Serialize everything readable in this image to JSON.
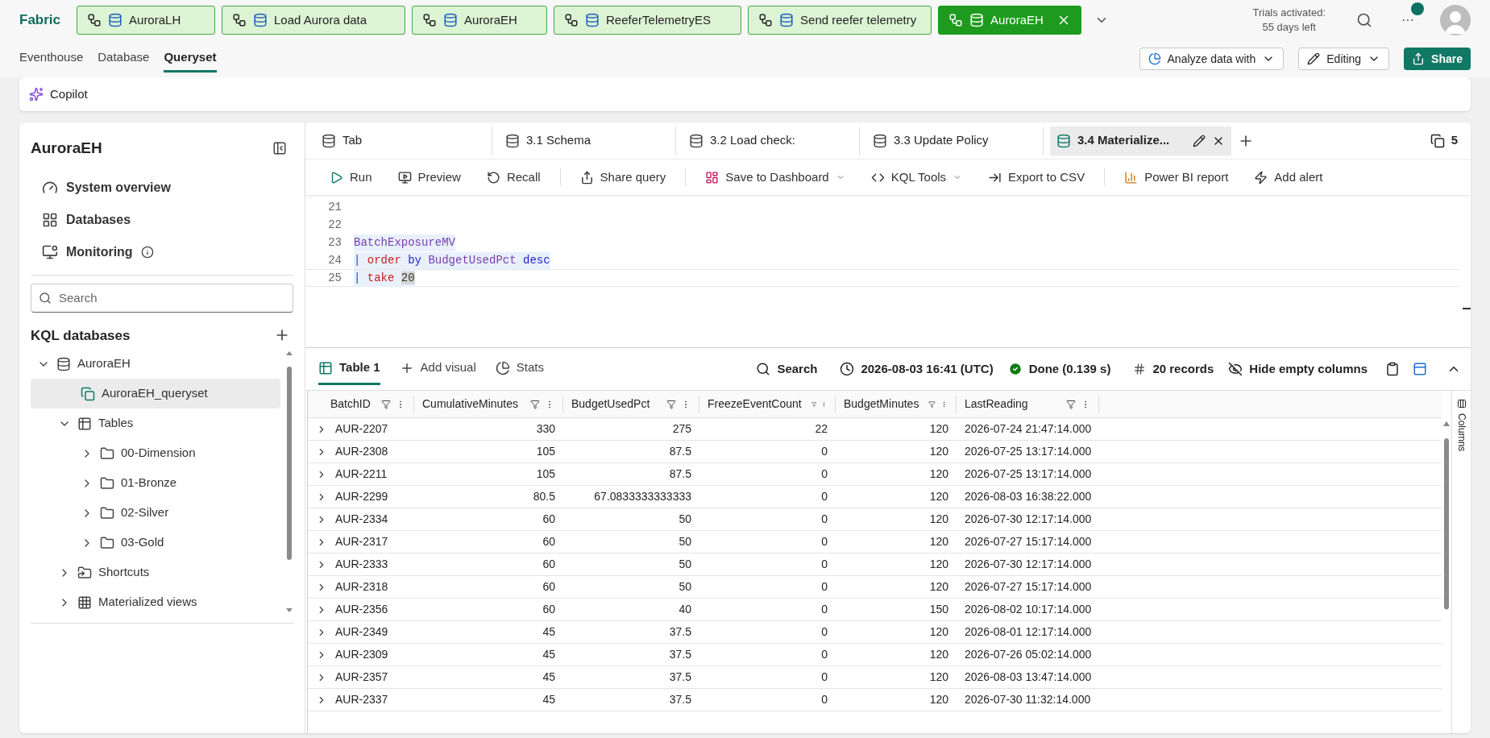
{
  "app_bar": {
    "brand": "Fabric",
    "tabs": [
      {
        "label": "AuroraLH",
        "selected": false
      },
      {
        "label": "Load Aurora data",
        "selected": false
      },
      {
        "label": "AuroraEH",
        "selected": false
      },
      {
        "label": "ReeferTelemetryES",
        "selected": false
      },
      {
        "label": "Send reefer telemetry",
        "selected": false
      },
      {
        "label": "AuroraEH",
        "selected": true
      }
    ],
    "trial": [
      "Trials activated:",
      "55 days left"
    ],
    "more": "···"
  },
  "nav_tabs": [
    {
      "label": "Eventhouse",
      "selected": false
    },
    {
      "label": "Database",
      "selected": false
    },
    {
      "label": "Queryset",
      "selected": true
    }
  ],
  "actions": [
    {
      "label": "Analyze data with",
      "kind": "menu"
    },
    {
      "label": "Editing",
      "kind": "menu"
    },
    {
      "label": "Share",
      "kind": "primary"
    }
  ],
  "copilot": {
    "label": "Copilot"
  },
  "sidebar": {
    "title": "AuroraEH",
    "nav": [
      {
        "label": "System overview",
        "info": false
      },
      {
        "label": "Databases",
        "info": false
      },
      {
        "label": "Monitoring",
        "info": true
      }
    ],
    "search": {
      "placeholder": "Search"
    },
    "section": "KQL databases",
    "tree": [
      {
        "label": "AuroraEH",
        "kind": "database",
        "expanded": true,
        "selected": false,
        "children": [
          {
            "label": "AuroraEH_queryset",
            "kind": "queryset",
            "selected": true
          },
          {
            "label": "Tables",
            "kind": "tables",
            "expanded": true,
            "selected": false,
            "children": [
              {
                "label": "00-Dimension",
                "kind": "folder",
                "expanded": false,
                "selected": false
              },
              {
                "label": "01-Bronze",
                "kind": "folder",
                "expanded": false,
                "selected": false
              },
              {
                "label": "02-Silver",
                "kind": "folder",
                "expanded": false,
                "selected": false
              },
              {
                "label": "03-Gold",
                "kind": "folder",
                "expanded": false,
                "selected": false
              }
            ]
          },
          {
            "label": "Shortcuts",
            "kind": "shortcuts",
            "expanded": false,
            "selected": false
          },
          {
            "label": "Materialized views",
            "kind": "views",
            "expanded": false,
            "selected": false
          }
        ]
      }
    ]
  },
  "query_tabs": [
    {
      "label": "Tab",
      "selected": false
    },
    {
      "label": "3.1 Schema",
      "selected": false
    },
    {
      "label": "3.2 Load check:",
      "selected": false
    },
    {
      "label": "3.3 Update Policy",
      "selected": false
    },
    {
      "label": "3.4 Materialize...",
      "selected": true
    }
  ],
  "tab_count": "5",
  "toolbar": [
    {
      "items": [
        {
          "label": "Run",
          "caret": false
        },
        {
          "label": "Preview",
          "caret": false
        },
        {
          "label": "Recall",
          "caret": false
        }
      ]
    },
    {
      "items": [
        {
          "label": "Share query",
          "caret": false
        }
      ]
    },
    {
      "items": [
        {
          "label": "Save to Dashboard",
          "caret": true
        },
        {
          "label": "KQL Tools",
          "caret": true
        },
        {
          "label": "Export to CSV",
          "caret": false
        }
      ]
    },
    {
      "items": [
        {
          "label": "Power BI report",
          "caret": false
        },
        {
          "label": "Add alert",
          "caret": false
        }
      ]
    }
  ],
  "editor": {
    "lines": [
      {
        "number": "21"
      },
      {
        "number": "22"
      },
      {
        "number": "23",
        "tokens": [
          {
            "text": "BatchExposureMV",
            "kind": "table"
          }
        ]
      },
      {
        "number": "24",
        "tokens": [
          {
            "text": "|",
            "kind": "pipe"
          },
          {
            "text": "order",
            "kind": "operator"
          },
          {
            "text": "by",
            "kind": "keyword"
          },
          {
            "text": "BudgetUsedPct",
            "kind": "column"
          },
          {
            "text": "desc",
            "kind": "keyword"
          }
        ]
      },
      {
        "number": "25",
        "tokens": [
          {
            "text": "|",
            "kind": "pipe"
          },
          {
            "text": "take",
            "kind": "operator"
          },
          {
            "text": "20",
            "kind": "number"
          }
        ]
      }
    ]
  },
  "results": {
    "tabs": [
      {
        "label": "Table 1",
        "selected": true
      },
      {
        "label": "Add visual",
        "selected": false
      },
      {
        "label": "Stats",
        "selected": false
      }
    ],
    "search": "Search",
    "time": "2026-08-03 16:41 (UTC)",
    "status": "Done (0.139 s)",
    "records": "20 records",
    "hide_empty": "Hide empty columns",
    "columns_panel": "Columns"
  },
  "table": {
    "columns": [
      "BatchID",
      "CumulativeMinutes",
      "BudgetUsedPct",
      "FreezeEventCount",
      "BudgetMinutes",
      "LastReading"
    ],
    "rows": [
      [
        "AUR-2207",
        "330",
        "275",
        "22",
        "120",
        "2026-07-24 21:47:14.000"
      ],
      [
        "AUR-2308",
        "105",
        "87.5",
        "0",
        "120",
        "2026-07-25 13:17:14.000"
      ],
      [
        "AUR-2211",
        "105",
        "87.5",
        "0",
        "120",
        "2026-07-25 13:17:14.000"
      ],
      [
        "AUR-2299",
        "80.5",
        "67.0833333333333",
        "0",
        "120",
        "2026-08-03 16:38:22.000"
      ],
      [
        "AUR-2334",
        "60",
        "50",
        "0",
        "120",
        "2026-07-30 12:17:14.000"
      ],
      [
        "AUR-2317",
        "60",
        "50",
        "0",
        "120",
        "2026-07-27 15:17:14.000"
      ],
      [
        "AUR-2333",
        "60",
        "50",
        "0",
        "120",
        "2026-07-30 12:17:14.000"
      ],
      [
        "AUR-2318",
        "60",
        "50",
        "0",
        "120",
        "2026-07-27 15:17:14.000"
      ],
      [
        "AUR-2356",
        "60",
        "40",
        "0",
        "150",
        "2026-08-02 10:17:14.000"
      ],
      [
        "AUR-2349",
        "45",
        "37.5",
        "0",
        "120",
        "2026-08-01 12:17:14.000"
      ],
      [
        "AUR-2309",
        "45",
        "37.5",
        "0",
        "120",
        "2026-07-26 05:02:14.000"
      ],
      [
        "AUR-2357",
        "45",
        "37.5",
        "0",
        "120",
        "2026-08-03 13:47:14.000"
      ],
      [
        "AUR-2337",
        "45",
        "37.5",
        "0",
        "120",
        "2026-07-30 11:32:14.000"
      ]
    ]
  }
}
